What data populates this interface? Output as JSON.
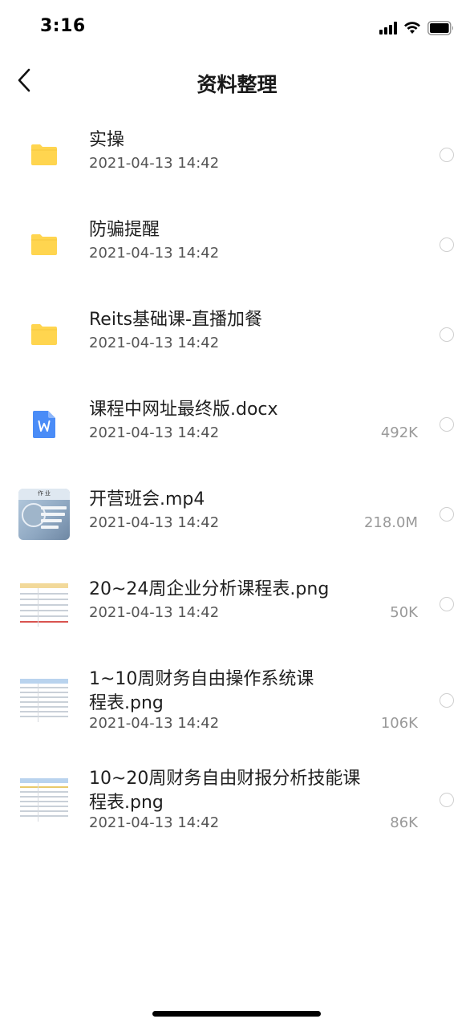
{
  "status_bar": {
    "time": "3:16",
    "icons": [
      "cellular-signal-icon",
      "wifi-icon",
      "battery-icon"
    ]
  },
  "nav": {
    "title": "资料整理",
    "back_icon": "chevron-left-icon"
  },
  "files": [
    {
      "name": "实操",
      "date": "2021-04-13 14:42",
      "size": "",
      "type": "folder"
    },
    {
      "name": "防骗提醒",
      "date": "2021-04-13 14:42",
      "size": "",
      "type": "folder"
    },
    {
      "name": "Reits基础课-直播加餐",
      "date": "2021-04-13 14:42",
      "size": "",
      "type": "folder"
    },
    {
      "name": "课程中网址最终版.docx",
      "date": "2021-04-13 14:42",
      "size": "492K",
      "type": "word-doc"
    },
    {
      "name": "开营班会.mp4",
      "date": "2021-04-13 14:42",
      "size": "218.0M",
      "type": "video"
    },
    {
      "name": "20~24周企业分析课程表.png",
      "date": "2021-04-13 14:42",
      "size": "50K",
      "type": "image"
    },
    {
      "name": "1~10周财务自由操作系统课程表.png",
      "date": "2021-04-13 14:42",
      "size": "106K",
      "type": "image"
    },
    {
      "name": "10~20周财务自由财报分析技能课程表.png",
      "date": "2021-04-13 14:42",
      "size": "86K",
      "type": "image"
    }
  ],
  "colors": {
    "folder": "#FFD54F",
    "word": "#4A8CF7",
    "radio_border": "#CFCFCF",
    "date_text": "#555555",
    "size_text": "#999999"
  }
}
